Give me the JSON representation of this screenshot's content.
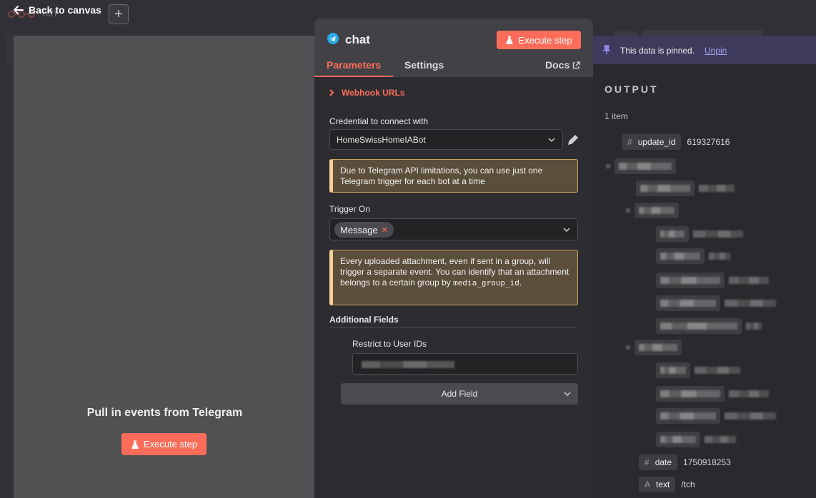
{
  "app": {
    "back_label": "Back to canvas",
    "workflow_title": "Tch"
  },
  "left_panel": {
    "title": "Pull in events from Telegram",
    "execute_label": "Execute step"
  },
  "node": {
    "name": "chat",
    "execute_label": "Execute step",
    "tabs": {
      "parameters": "Parameters",
      "settings": "Settings",
      "docs": "Docs"
    },
    "webhook_label": "Webhook URLs",
    "credential": {
      "label": "Credential to connect with",
      "value": "HomeSwissHomeIABot"
    },
    "notice_1": "Due to Telegram API limitations, you can use just one Telegram trigger for each bot at a time",
    "trigger": {
      "label": "Trigger On",
      "chip": "Message"
    },
    "notice_2": {
      "text": "Every uploaded attachment, even if sent in a group, will trigger a separate event. You can identify that an attachment belongs to a certain group by ",
      "code": "media_group_id",
      "end": "."
    },
    "additional_fields_label": "Additional Fields",
    "restrict_label": "Restrict to User IDs",
    "add_field_label": "Add Field"
  },
  "output": {
    "pinned_text": "This data is pinned.",
    "unpin_label": "Unpin",
    "title": "OUTPUT",
    "item_count": "1 item",
    "update_id": {
      "key": "update_id",
      "value": "619327616"
    },
    "date": {
      "key": "date",
      "value": "1750918253"
    },
    "text": {
      "key": "text",
      "value": "/tch"
    }
  },
  "colors": {
    "accent": "#ff6d5a",
    "telegram": "#29a9eb",
    "pin_bar": "#3e3a5c",
    "notice_border": "#f6d095"
  }
}
